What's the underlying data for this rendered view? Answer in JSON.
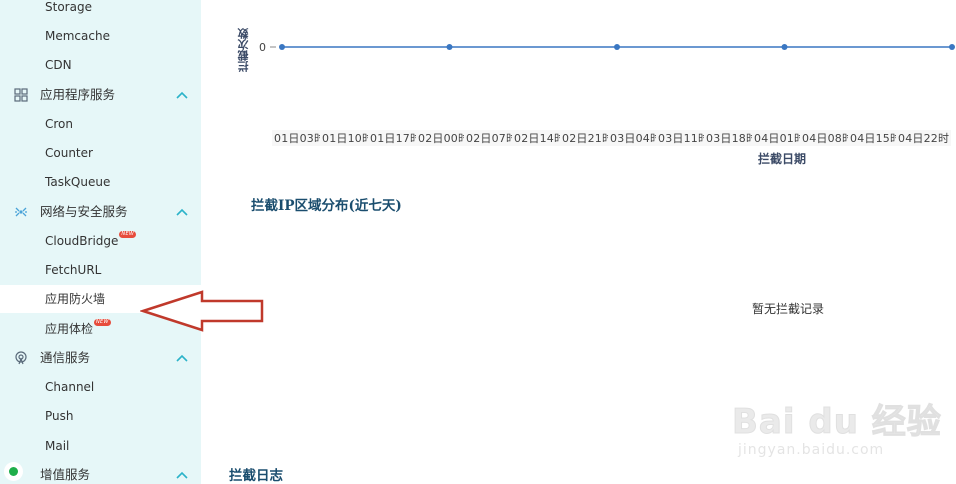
{
  "sidebar": {
    "groups": [
      {
        "label": "应用程序服务",
        "icon": "grid-icon"
      },
      {
        "label": "网络与安全服务",
        "icon": "network-icon"
      },
      {
        "label": "通信服务",
        "icon": "signal-icon"
      },
      {
        "label": "增值服务",
        "icon": "status-dot-icon"
      }
    ],
    "items": {
      "storage": "Storage",
      "memcache": "Memcache",
      "cdn": "CDN",
      "cron": "Cron",
      "counter": "Counter",
      "taskqueue": "TaskQueue",
      "cloudbridge": "CloudBridge",
      "fetchurl": "FetchURL",
      "firewall": "应用防火墙",
      "checkup": "应用体检",
      "channel": "Channel",
      "push": "Push",
      "mail": "Mail"
    },
    "new_badge": "NEW",
    "active_item": "应用防火墙"
  },
  "chart_data": {
    "type": "line",
    "ylabel": "拦截次数",
    "xlabel": "拦截日期",
    "y_ticks": [
      "0"
    ],
    "x": [
      "01日03时",
      "01日10时",
      "01日17时",
      "02日00时",
      "02日07时",
      "02日14时",
      "02日21时",
      "03日04时",
      "03日11时",
      "03日18时",
      "04日01时",
      "04日08时",
      "04日15时",
      "04日22时"
    ],
    "series": [
      {
        "values": [
          0,
          0,
          0,
          0,
          0
        ],
        "color": "#3a77c2"
      }
    ]
  },
  "sections": {
    "ip_region_title": "拦截IP区域分布(近七天)",
    "empty_note": "暂无拦截记录",
    "log_title": "拦截日志"
  },
  "watermark": {
    "brand": "Bai du 经验",
    "sub": "jingyan.baidu.com"
  }
}
